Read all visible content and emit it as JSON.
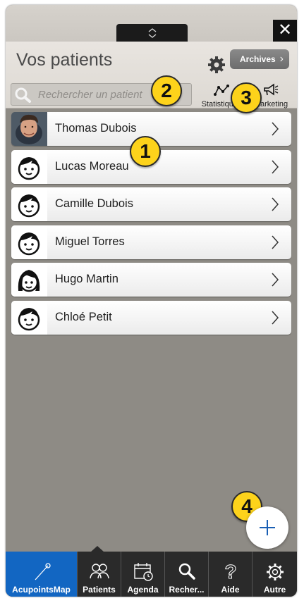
{
  "window": {
    "handle_icon": "chevron-up-down-icon",
    "close_label": "✕"
  },
  "header": {
    "title": "Vos patients",
    "settings_icon": "gear-icon",
    "archives_label": "Archives"
  },
  "search": {
    "placeholder": "Rechercher un patient",
    "icon": "search-icon"
  },
  "tools": {
    "stats_label": "Statistiques",
    "marketing_label": "Marketing"
  },
  "patients": [
    {
      "name": "Thomas Dubois",
      "avatar": "photo"
    },
    {
      "name": "Lucas Moreau",
      "avatar": "boy-icon"
    },
    {
      "name": "Camille Dubois",
      "avatar": "boy-icon"
    },
    {
      "name": "Miguel Torres",
      "avatar": "boy-icon"
    },
    {
      "name": "Hugo Martin",
      "avatar": "girl-icon"
    },
    {
      "name": "Chloé Petit",
      "avatar": "boy-icon"
    }
  ],
  "badges": [
    "1",
    "2",
    "3",
    "4"
  ],
  "fab": {
    "label": "+"
  },
  "tabs": [
    {
      "label": "AcupointsMap",
      "icon": "acupuncture-needle-icon",
      "active": true
    },
    {
      "label": "Patients",
      "icon": "people-icon",
      "active": false
    },
    {
      "label": "Agenda",
      "icon": "calendar-icon",
      "active": false
    },
    {
      "label": "Recher...",
      "icon": "search-icon",
      "active": false
    },
    {
      "label": "Aide",
      "icon": "help-icon",
      "active": false
    },
    {
      "label": "Autre",
      "icon": "gear-icon",
      "active": false
    }
  ],
  "colors": {
    "accent": "#1266c2",
    "badge": "#fdd31b",
    "background": "#8e8b85"
  }
}
